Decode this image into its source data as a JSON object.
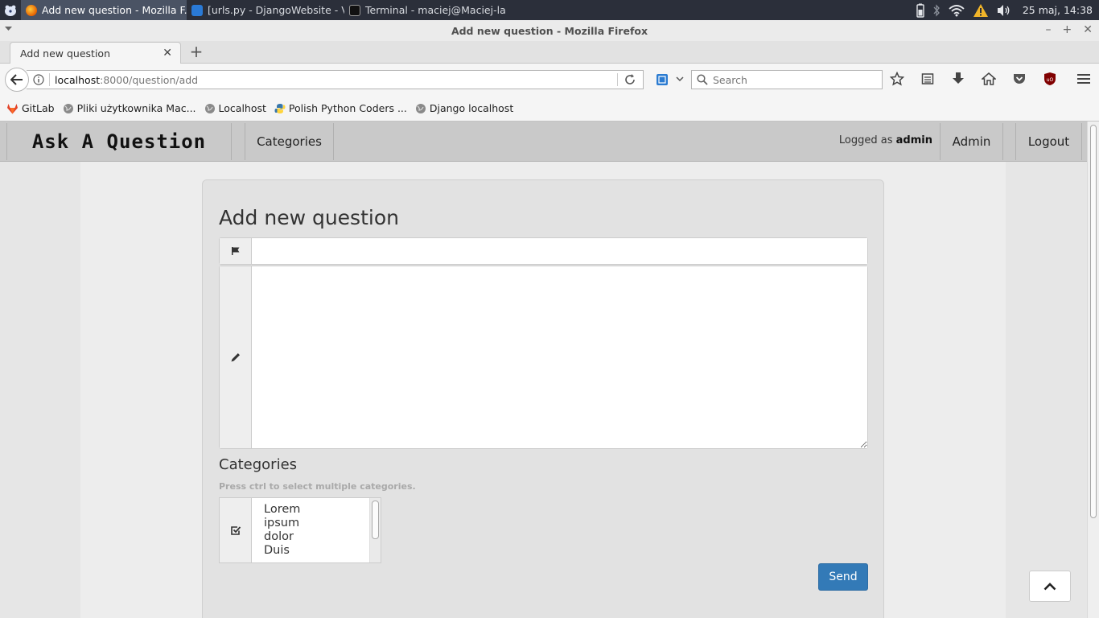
{
  "taskbar": {
    "tasks": [
      {
        "label": "Add new question - Mozilla F..."
      },
      {
        "label": "[urls.py - DjangoWebsite - Vi..."
      },
      {
        "label": "Terminal - maciej@Maciej-la..."
      }
    ],
    "clock": "25 maj, 14:38"
  },
  "window": {
    "title": "Add new question - Mozilla Firefox"
  },
  "tab": {
    "label": "Add new question"
  },
  "urlbar": {
    "host": "localhost",
    "path": ":8000/question/add"
  },
  "search": {
    "placeholder": "Search"
  },
  "bookmarks": [
    {
      "label": "GitLab"
    },
    {
      "label": "Pliki użytkownika Mac..."
    },
    {
      "label": "Localhost"
    },
    {
      "label": "Polish Python Coders ..."
    },
    {
      "label": "Django localhost"
    }
  ],
  "site": {
    "brand": "Ask A Question",
    "nav_categories": "Categories",
    "logged_prefix": "Logged as",
    "logged_user": "admin",
    "admin": "Admin",
    "logout": "Logout"
  },
  "form": {
    "title": "Add new question",
    "title_value": "",
    "body_value": "",
    "categories_heading": "Categories",
    "categories_help": "Press ctrl to select multiple categories.",
    "category_options": [
      "Lorem",
      "ipsum",
      "dolor",
      "Duis"
    ],
    "send": "Send"
  },
  "colors": {
    "primary_button": "#337ab7",
    "navbar": "#c9c9c9"
  }
}
